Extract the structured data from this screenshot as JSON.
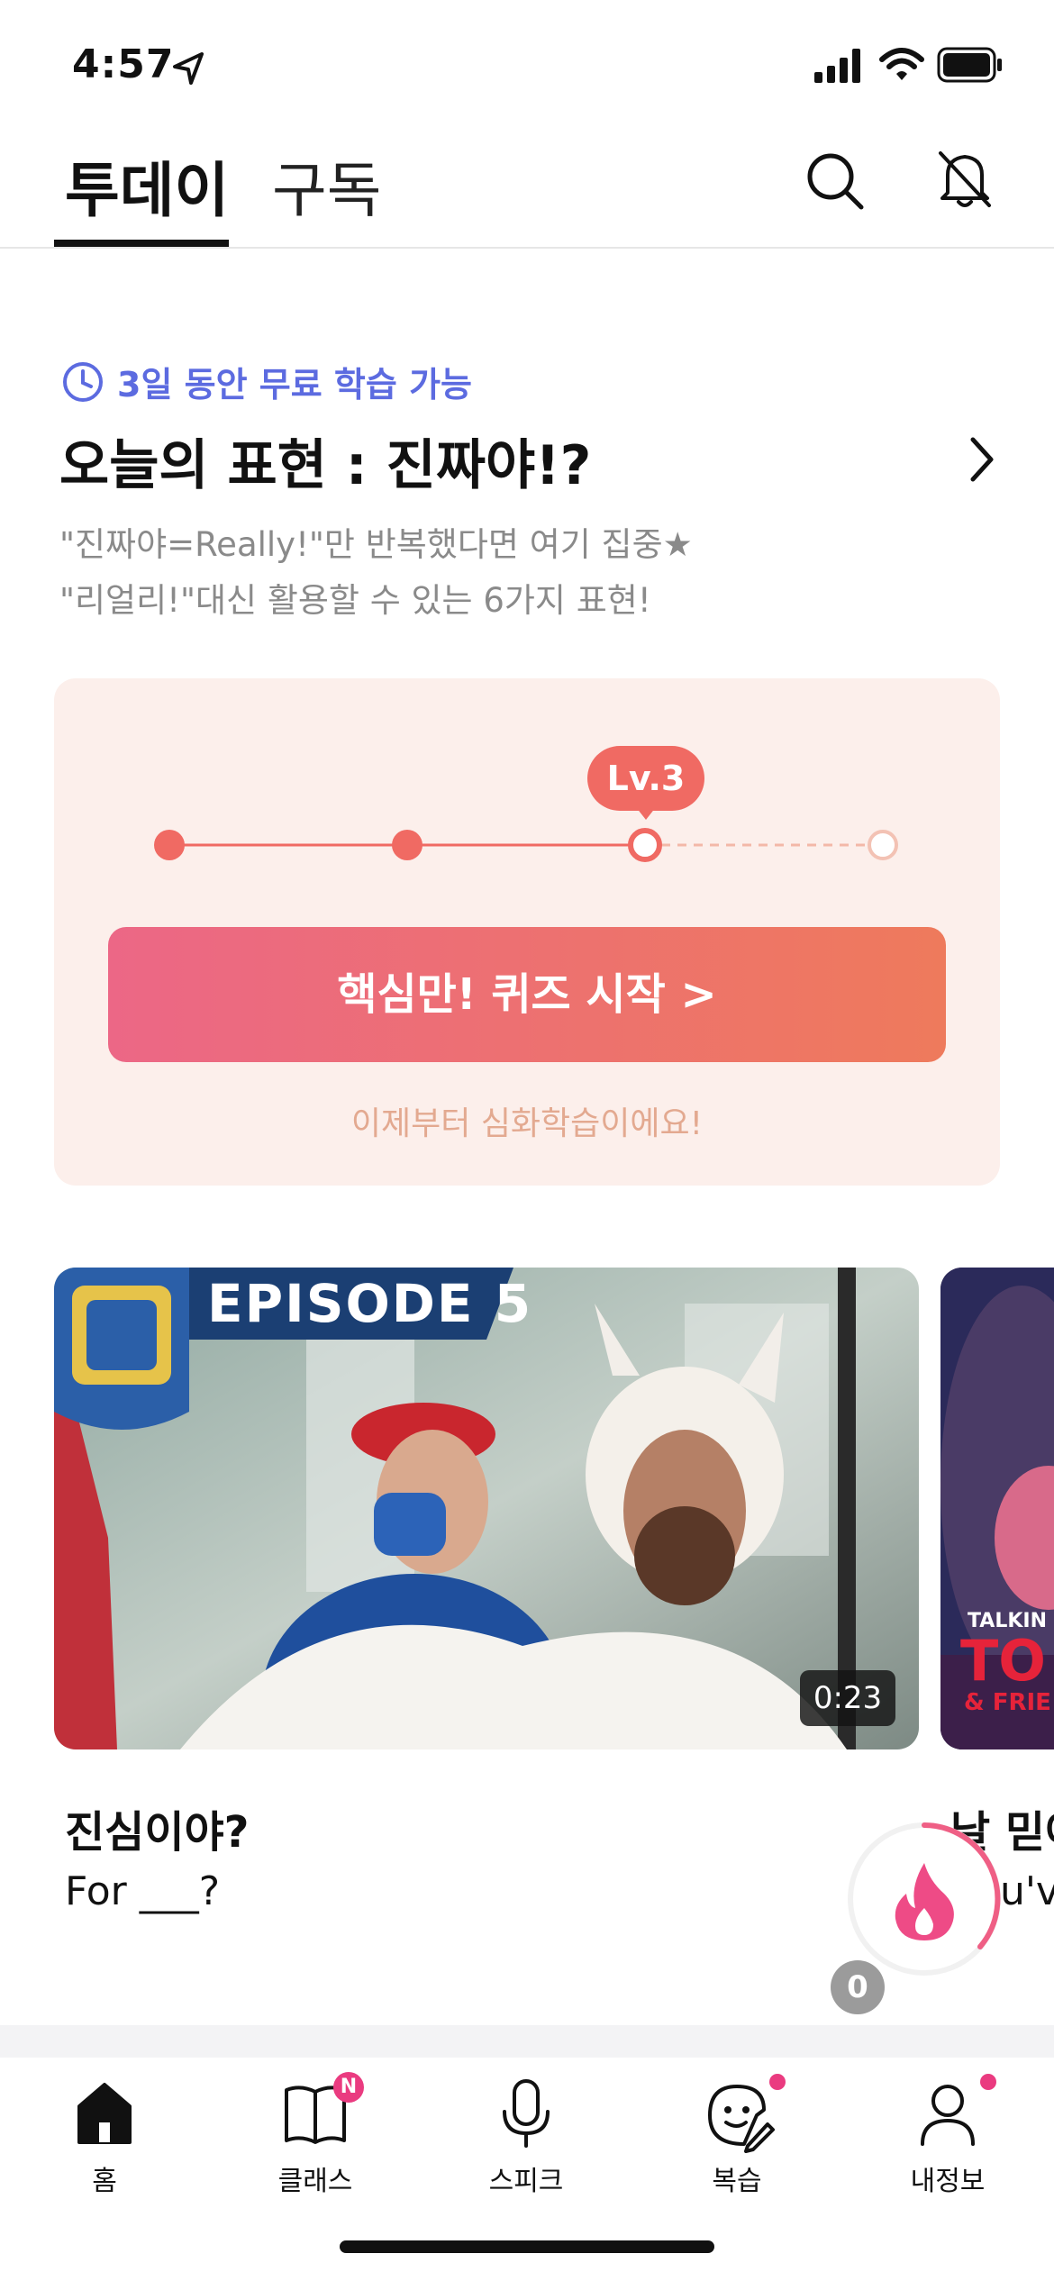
{
  "status_bar": {
    "time": "4:57"
  },
  "header": {
    "tabs": [
      {
        "label": "투데이",
        "active": true
      },
      {
        "label": "구독",
        "active": false
      }
    ],
    "icons": [
      "search-icon",
      "bell-off-icon"
    ]
  },
  "today_card": {
    "free_badge": "3일 동안 무료 학습 가능",
    "title": "오늘의 표현 : 진짜야!?",
    "description_line1": "\"진짜야=Really!\"만 반복했다면 여기 집중★",
    "description_line2": "\"리얼리!\"대신 활용할 수 있는 6가지 표현!"
  },
  "quiz": {
    "level_label": "Lv.3",
    "progress": {
      "current_level": 3,
      "total_levels": 4
    },
    "button_label": "핵심만! 퀴즈 시작 >",
    "hint": "이제부터 심화학습이에요!"
  },
  "videos": [
    {
      "banner": "EPISODE 5",
      "duration": "0:23",
      "title": "진심이야?",
      "subtitle": "For ___?"
    },
    {
      "title": "날 믿어",
      "subtitle": "You've",
      "logo_text_line1": "TALKIN",
      "logo_text_line2": "TO",
      "logo_text_line3": "& FRIE"
    }
  ],
  "streak": {
    "count": "0"
  },
  "bottom_nav": {
    "items": [
      {
        "label": "홈",
        "icon": "home-icon",
        "active": true
      },
      {
        "label": "클래스",
        "icon": "book-icon",
        "badge": "N"
      },
      {
        "label": "스피크",
        "icon": "mic-icon"
      },
      {
        "label": "복습",
        "icon": "review-icon",
        "dot": true
      },
      {
        "label": "내정보",
        "icon": "profile-icon",
        "dot": true
      }
    ]
  },
  "colors": {
    "accent_blue": "#5c6be0",
    "accent_coral": "#f06a63",
    "gradient_start": "#ec6786",
    "gradient_end": "#ee7a5c",
    "badge_pink": "#ea3b80"
  }
}
